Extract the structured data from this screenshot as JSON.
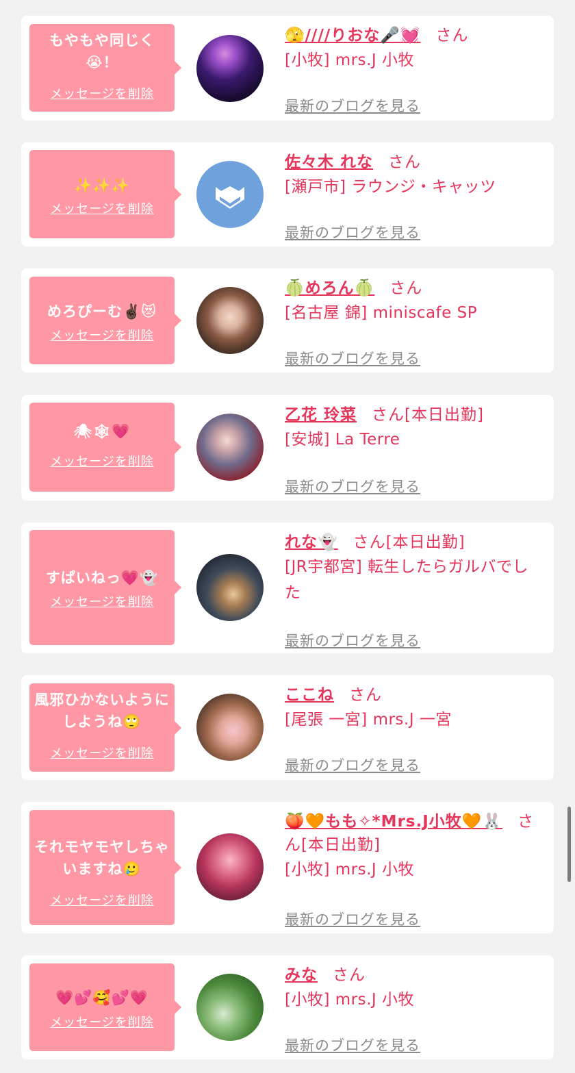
{
  "common": {
    "delete_label": "メッセージを削除",
    "blog_label": "最新のブログを見る",
    "honorific": "さん"
  },
  "messages": [
    {
      "bubble": "もやもや同じく😭！",
      "name": "🫣////りおな🎤💓",
      "status": "",
      "shop": "[小牧] mrs.J 小牧"
    },
    {
      "bubble": "✨✨✨",
      "name": "佐々木 れな",
      "status": "",
      "shop": "[瀬戸市] ラウンジ・キャッツ"
    },
    {
      "bubble": "めろぴーむ✌🏿😻",
      "name": "🍈めろん🍈",
      "status": "",
      "shop": "[名古屋 錦] miniscafe SP"
    },
    {
      "bubble": "🕷🕸💗",
      "name": "乙花 玲菜",
      "status": "[本日出勤]",
      "shop": "[安城] La Terre"
    },
    {
      "bubble": "すぱいねっ💗👻",
      "name": "れな👻",
      "status": "[本日出勤]",
      "shop": "[JR宇都宮] 転生したらガルバでした"
    },
    {
      "bubble": "風邪ひかないようにしようね🙄",
      "name": "ここね",
      "status": "",
      "shop": "[尾張 一宮] mrs.J 一宮"
    },
    {
      "bubble": "それモヤモヤしちゃいますね🥲",
      "name": "🍑🧡もも✧*Mrs.J小牧🧡🐰",
      "status": "[本日出勤]",
      "shop": "[小牧] mrs.J 小牧"
    },
    {
      "bubble": "💗💕🥰💕💗",
      "name": "みな",
      "status": "",
      "shop": "[小牧] mrs.J 小牧"
    }
  ],
  "colors": {
    "background": "#f1f1f1",
    "bubble": "#ff98a4",
    "accent": "#e6355a",
    "link_gray": "#8a8a8a"
  }
}
